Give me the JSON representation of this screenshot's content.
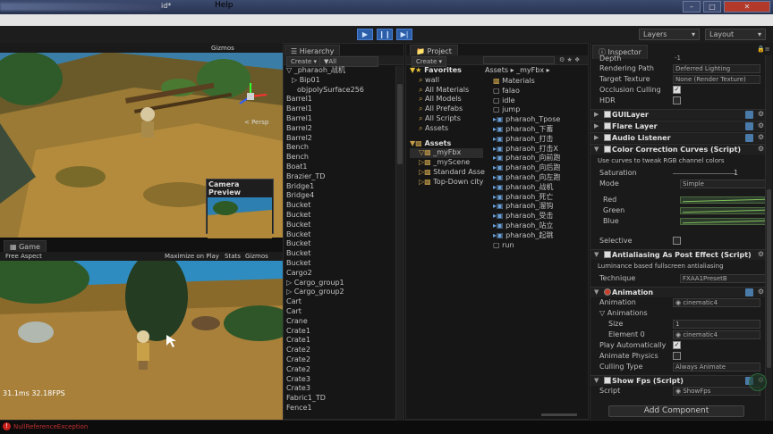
{
  "window": {
    "title_suffix": "id*"
  },
  "menu": {
    "help": "Help"
  },
  "toolbar": {
    "play_icon": "play-icon",
    "pause_icon": "pause-icon",
    "step_icon": "step-icon",
    "layers_label": "Layers",
    "layout_label": "Layout"
  },
  "scene": {
    "gizmos": "Gizmos",
    "persp": "< Persp",
    "camera_preview": "Camera Preview"
  },
  "game": {
    "tab": "Game",
    "aspect": "Free Aspect",
    "maximize": "Maximize on Play",
    "stats": "Stats",
    "gizmos": "Gizmos",
    "fps": "31.1ms  32.18FPS"
  },
  "hierarchy": {
    "tab": "Hierarchy",
    "create": "Create",
    "search": "▼All",
    "items": [
      {
        "label": "▽ _pharaoh_战机",
        "indent": 0
      },
      {
        "label": "▷ Bip01",
        "indent": 1
      },
      {
        "label": "objpolySurface256",
        "indent": 2
      },
      {
        "label": "Barrel1",
        "indent": 0
      },
      {
        "label": "Barrel1",
        "indent": 0
      },
      {
        "label": "Barrel1",
        "indent": 0
      },
      {
        "label": "Barrel2",
        "indent": 0
      },
      {
        "label": "Barrel2",
        "indent": 0
      },
      {
        "label": "Bench",
        "indent": 0
      },
      {
        "label": "Bench",
        "indent": 0
      },
      {
        "label": "Boat1",
        "indent": 0
      },
      {
        "label": "Brazier_TD",
        "indent": 0
      },
      {
        "label": "Bridge1",
        "indent": 0
      },
      {
        "label": "Bridge4",
        "indent": 0
      },
      {
        "label": "Bucket",
        "indent": 0
      },
      {
        "label": "Bucket",
        "indent": 0
      },
      {
        "label": "Bucket",
        "indent": 0
      },
      {
        "label": "Bucket",
        "indent": 0
      },
      {
        "label": "Bucket",
        "indent": 0
      },
      {
        "label": "Bucket",
        "indent": 0
      },
      {
        "label": "Bucket",
        "indent": 0
      },
      {
        "label": "Cargo2",
        "indent": 0
      },
      {
        "label": "▷ Cargo_group1",
        "indent": 0
      },
      {
        "label": "▷ Cargo_group2",
        "indent": 0
      },
      {
        "label": "Cart",
        "indent": 0
      },
      {
        "label": "Cart",
        "indent": 0
      },
      {
        "label": "Crane",
        "indent": 0
      },
      {
        "label": "Crate1",
        "indent": 0
      },
      {
        "label": "Crate1",
        "indent": 0
      },
      {
        "label": "Crate2",
        "indent": 0
      },
      {
        "label": "Crate2",
        "indent": 0
      },
      {
        "label": "Crate2",
        "indent": 0
      },
      {
        "label": "Crate3",
        "indent": 0
      },
      {
        "label": "Crate3",
        "indent": 0
      },
      {
        "label": "Fabric1_TD",
        "indent": 0
      },
      {
        "label": "Fence1",
        "indent": 0
      }
    ]
  },
  "project": {
    "tab": "Project",
    "create": "Create",
    "favorites_title": "Favorites",
    "favorites": [
      "wall",
      "All Materials",
      "All Models",
      "All Prefabs",
      "All Scripts",
      "Assets"
    ],
    "assets_title": "Assets",
    "assets_tree": [
      "_myFbx",
      "_myScene",
      "Standard Asse",
      "Top-Down city"
    ],
    "breadcrumb": "Assets ▸ _myFbx ▸",
    "files": [
      "Materials",
      "falao",
      "idle",
      "jump",
      "pharaoh_Tpose",
      "pharaoh_下蓄",
      "pharaoh_打击",
      "pharaoh_打击X",
      "pharaoh_向前跑",
      "pharaoh_向后跑",
      "pharaoh_向左跑",
      "pharaoh_战机",
      "pharaoh_死亡",
      "pharaoh_溜钩",
      "pharaoh_受击",
      "pharaoh_站立",
      "pharaoh_起跳",
      "run"
    ]
  },
  "inspector": {
    "tab": "Inspector",
    "top_rows": [
      {
        "label": "Depth",
        "value": "-1"
      },
      {
        "label": "Rendering Path",
        "value": "Deferred Lighting"
      },
      {
        "label": "Target Texture",
        "value": "None (Render Texture)"
      },
      {
        "label": "Occlusion Culling",
        "check": true
      },
      {
        "label": "HDR",
        "check": false
      }
    ],
    "components": {
      "gui_layer": "GUILayer",
      "flare_layer": "Flare Layer",
      "audio_listener": "Audio Listener",
      "color_correction": "Color Correction Curves (Script)",
      "cc_desc": "Use curves to tweak RGB channel colors",
      "saturation_label": "Saturation",
      "saturation_value": "1",
      "mode_label": "Mode",
      "mode_value": "Simple",
      "red": "Red",
      "green": "Green",
      "blue": "Blue",
      "selective": "Selective",
      "antialias": "Antialiasing As Post Effect (Script)",
      "aa_desc": "Luminance based fullscreen antialiasing",
      "technique_label": "Technique",
      "technique_value": "FXAA1PresetB",
      "animation": "Animation",
      "anim_rows": [
        {
          "label": "Animation",
          "value": "◉ cinematic4"
        },
        {
          "label": "▽ Animations",
          "value": ""
        },
        {
          "label": "Size",
          "value": "1"
        },
        {
          "label": "Element 0",
          "value": "◉ cinematic4"
        }
      ],
      "play_auto": "Play Automatically",
      "animate_physics": "Animate Physics",
      "culling_label": "Culling Type",
      "culling_value": "Always Animate",
      "show_fps": "Show Fps (Script)",
      "script_label": "Script",
      "script_value": "◉ ShowFps",
      "add_component": "Add Component"
    }
  },
  "status": {
    "error": "NullReferenceException"
  },
  "colors": {
    "accent": "#2c5fa8",
    "error": "#c8201a",
    "curve_green": "#7fbf58"
  }
}
